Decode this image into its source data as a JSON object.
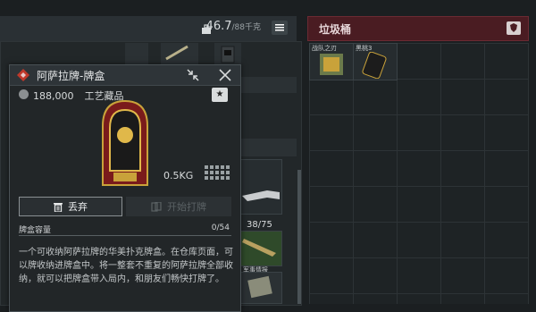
{
  "stash": {
    "weight_current": "46.7",
    "weight_max": "/88千克",
    "counter": "38/75",
    "military_label": "军事情报"
  },
  "trash": {
    "title": "垃圾桶",
    "items": [
      {
        "label": "战队之刃"
      },
      {
        "label": "黑桃3"
      }
    ]
  },
  "popup": {
    "title": "阿萨拉牌-牌盒",
    "price": "188,000",
    "category": "工艺藏品",
    "weight": "0.5KG",
    "discard_label": "丢弃",
    "play_label": "开始打牌",
    "capacity_label": "牌盒容量",
    "capacity_value": "0/54",
    "description": "一个可收纳阿萨拉牌的华美扑克牌盒。在仓库页面，可以牌收纳进牌盒中。将一整套不重复的阿萨拉牌全部收纳，就可以把牌盒带入局内，和朋友们畅快打牌了。"
  },
  "colors": {
    "accent_red": "#c0392b",
    "trash_header": "#4a1c22",
    "gold": "#c9a23a"
  }
}
